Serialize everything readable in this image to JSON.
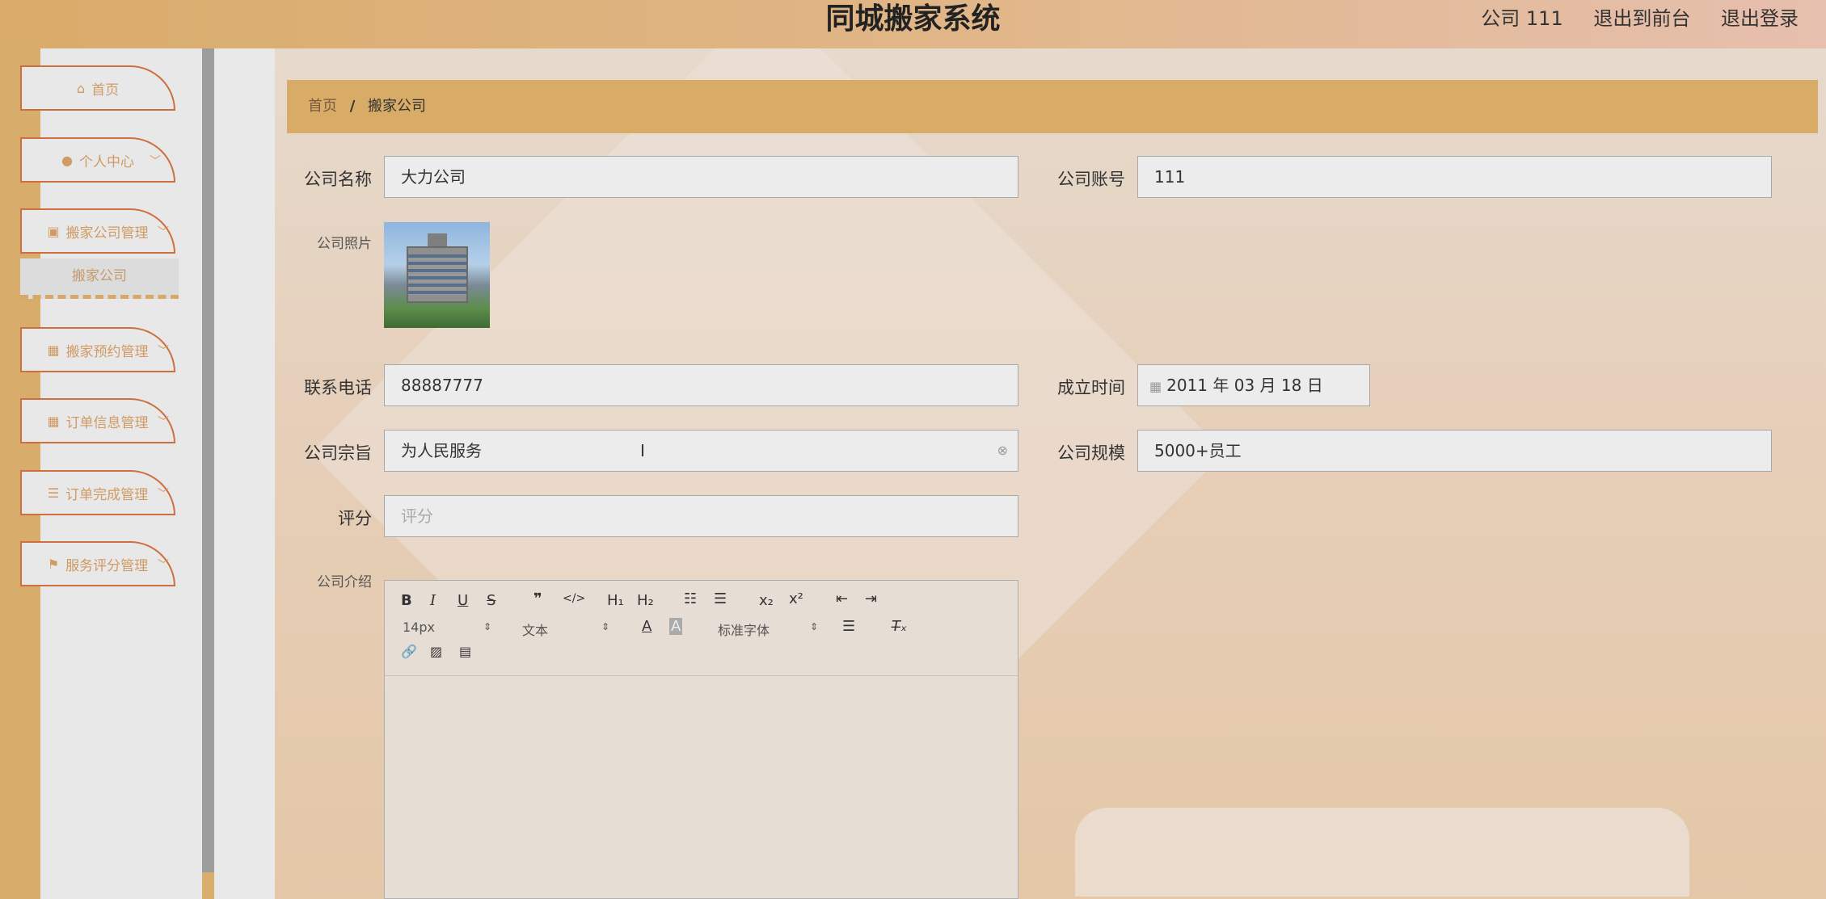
{
  "header": {
    "title": "同城搬家系统",
    "user": "公司 111",
    "back_to_front": "退出到前台",
    "logout": "退出登录"
  },
  "sidebar": {
    "items": [
      {
        "icon": "home-icon",
        "label": "首页"
      },
      {
        "icon": "user-icon",
        "label": "个人中心"
      },
      {
        "icon": "clipboard-icon",
        "label": "搬家公司管理"
      },
      {
        "icon": "grid-icon",
        "label": "搬家预约管理"
      },
      {
        "icon": "grid-icon",
        "label": "订单信息管理"
      },
      {
        "icon": "list-icon",
        "label": "订单完成管理"
      },
      {
        "icon": "flag-icon",
        "label": "服务评分管理"
      }
    ],
    "submenu": "搬家公司"
  },
  "breadcrumb": {
    "home": "首页",
    "separator": "/",
    "current": "搬家公司"
  },
  "form": {
    "company_name_label": "公司名称",
    "company_name": "大力公司",
    "company_account_label": "公司账号",
    "company_account": "111",
    "photo_label": "公司照片",
    "phone_label": "联系电话",
    "phone": "88887777",
    "founded_label": "成立时间",
    "founded": "2011 年 03 月 18 日",
    "purpose_label": "公司宗旨",
    "purpose": "为人民服务",
    "scale_label": "公司规模",
    "scale": "5000+员工",
    "rating_label": "评分",
    "rating_placeholder": "评分",
    "intro_label": "公司介绍"
  },
  "editor": {
    "font_size": "14px",
    "block_format": "文本",
    "font_family": "标准字体"
  }
}
